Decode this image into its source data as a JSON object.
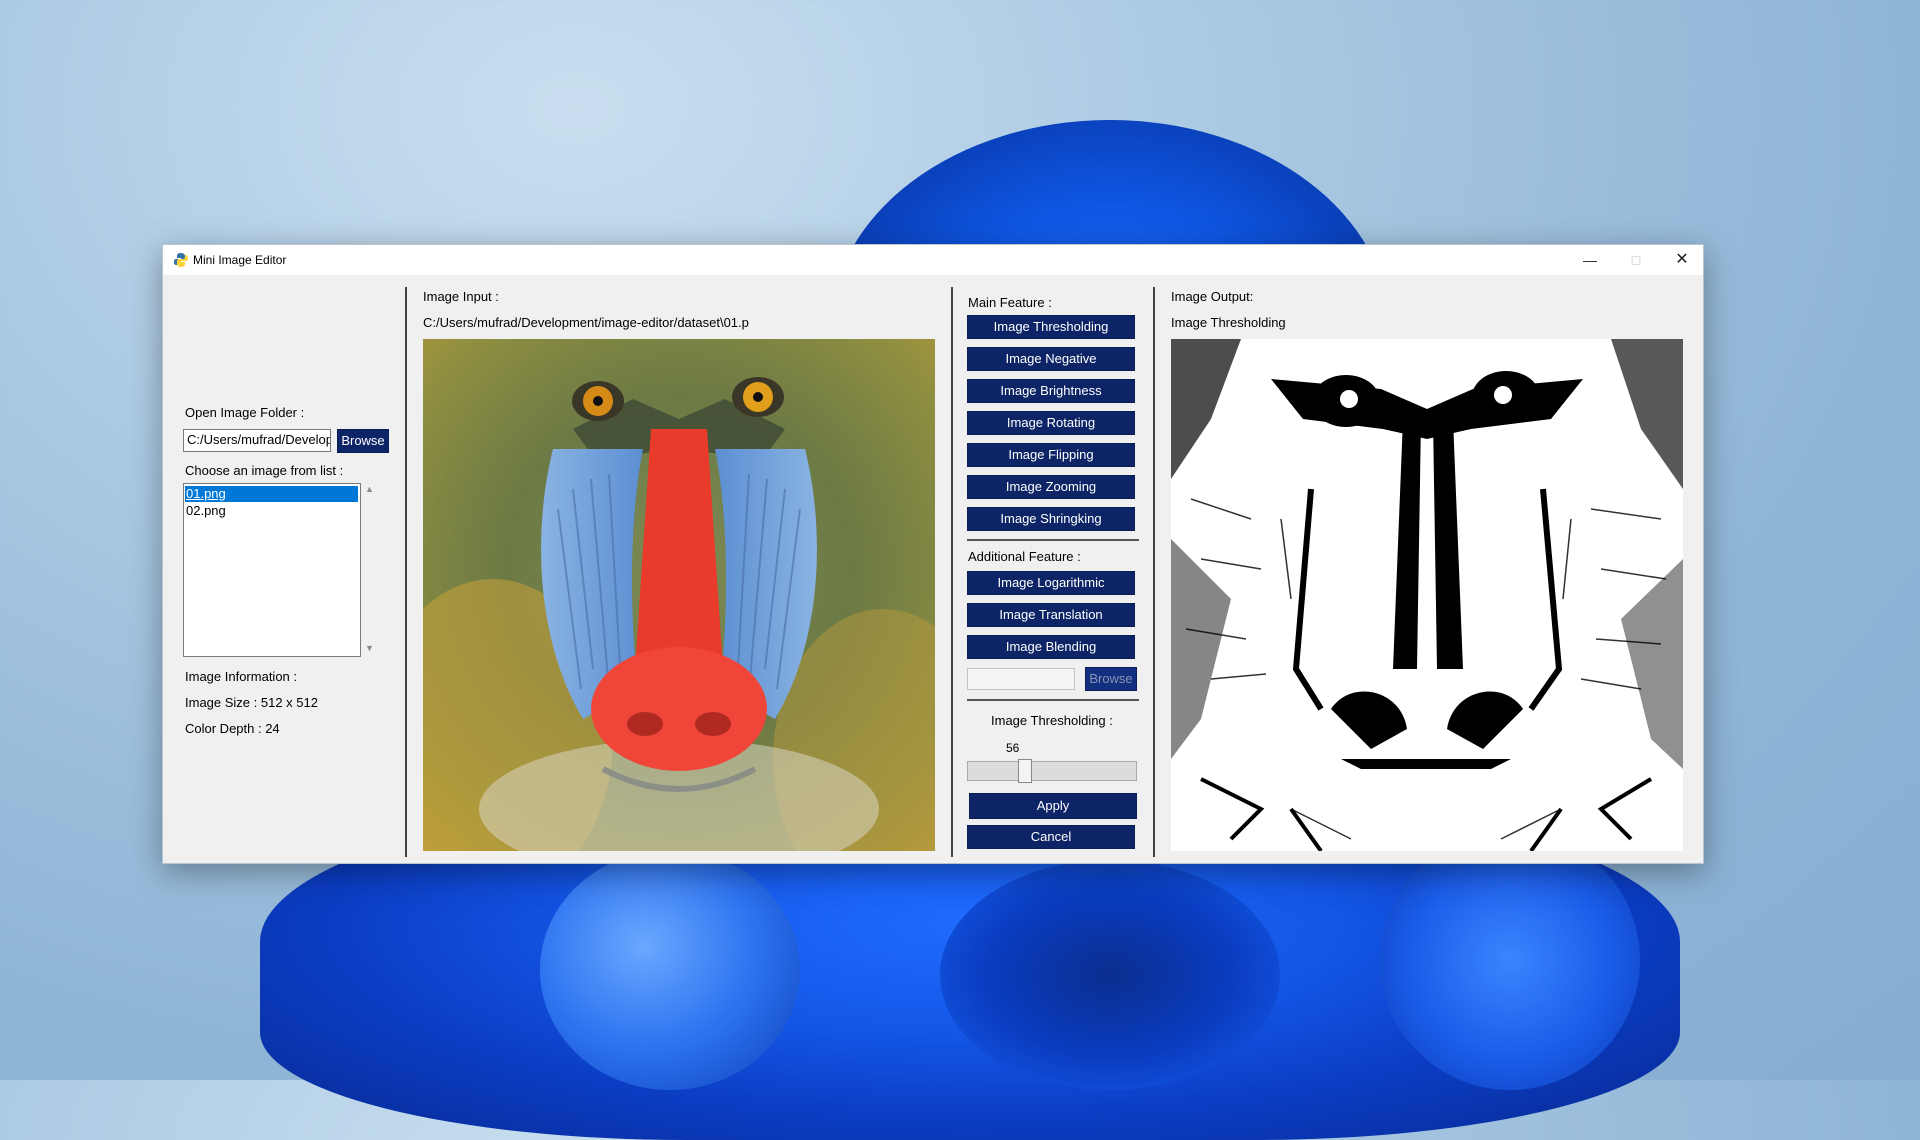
{
  "window": {
    "title": "Mini Image Editor"
  },
  "left": {
    "open_folder_label": "Open Image Folder :",
    "folder_path": "C:/Users/mufrad/Develop",
    "browse_label": "Browse",
    "choose_label": "Choose an image from list :",
    "files": [
      "01.png",
      "02.png"
    ],
    "info_label": "Image Information :",
    "size_text": "Image Size : 512 x 512",
    "depth_text": "Color Depth : 24"
  },
  "input": {
    "label": "Image Input :",
    "path": "C:/Users/mufrad/Development/image-editor/dataset\\01.p"
  },
  "features": {
    "main_label": "Main Feature :",
    "main_buttons": [
      "Image Thresholding",
      "Image Negative",
      "Image Brightness",
      "Image Rotating",
      "Image Flipping",
      "Image Zooming",
      "Image Shringking"
    ],
    "additional_label": "Additional Feature :",
    "additional_buttons": [
      "Image Logarithmic",
      "Image Translation",
      "Image Blending"
    ],
    "blend_browse": "Browse",
    "param_label": "Image Thresholding :",
    "slider_value": "56",
    "slider_fraction": 0.22,
    "apply_label": "Apply",
    "cancel_label": "Cancel"
  },
  "output": {
    "label": "Image Output:",
    "operation": "Image Thresholding"
  }
}
